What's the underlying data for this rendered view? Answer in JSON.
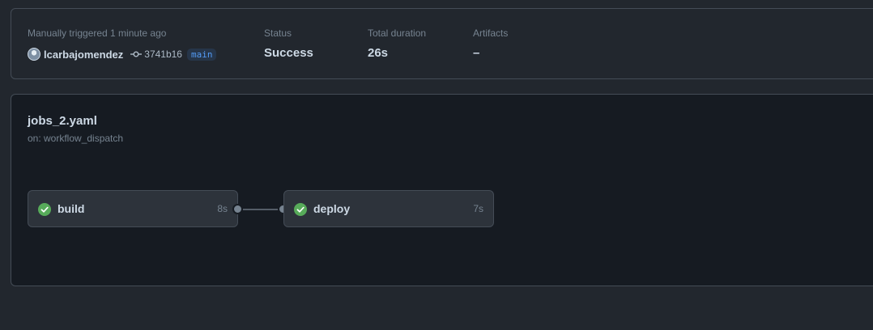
{
  "summary": {
    "trigger_label": "Manually triggered 1 minute ago",
    "actor": "lcarbajomendez",
    "commit_sha": "3741b16",
    "branch": "main",
    "status_label": "Status",
    "status_value": "Success",
    "duration_label": "Total duration",
    "duration_value": "26s",
    "artifacts_label": "Artifacts",
    "artifacts_value": "–"
  },
  "workflow": {
    "name": "jobs_2.yaml",
    "trigger": "on: workflow_dispatch"
  },
  "jobs": [
    {
      "name": "build",
      "duration": "8s",
      "status": "success",
      "icon": "check-circle-icon"
    },
    {
      "name": "deploy",
      "duration": "7s",
      "status": "success",
      "icon": "check-circle-icon"
    }
  ],
  "colors": {
    "success": "#57ab5a",
    "branch": "#539bf5"
  }
}
